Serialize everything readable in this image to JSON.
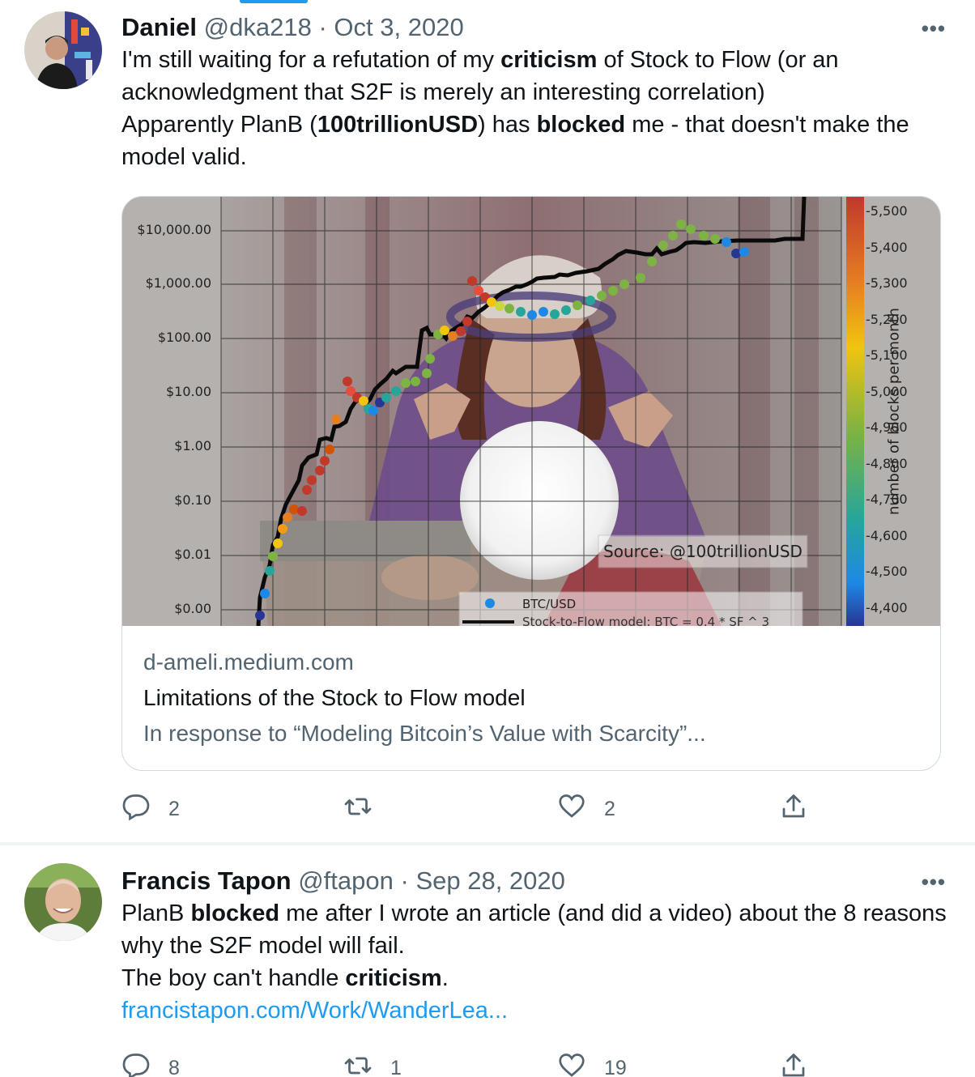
{
  "tweets": [
    {
      "name": "Daniel",
      "handle": "@dka218",
      "separator": "·",
      "date": "Oct 3, 2020",
      "more": "•••",
      "body": [
        {
          "t": "I'm still waiting for a refutation of my "
        },
        {
          "t": "criticism",
          "b": true
        },
        {
          "t": " of Stock to Flow (or an acknowledgment that S2F is merely an interesting correlation)"
        },
        {
          "br": true
        },
        {
          "t": "Apparently PlanB ("
        },
        {
          "t": "100trillionUSD",
          "b": true
        },
        {
          "t": ") has "
        },
        {
          "t": "blocked",
          "b": true
        },
        {
          "t": " me - that doesn't make the model valid."
        }
      ],
      "card": {
        "domain": "d-ameli.medium.com",
        "title": "Limitations of the Stock to Flow model",
        "description": "In response to “Modeling Bitcoin’s Value with Scarcity”..."
      },
      "actions": {
        "reply": "2",
        "retweet": "",
        "like": "2"
      }
    },
    {
      "name": "Francis Tapon",
      "handle": "@ftapon",
      "separator": "·",
      "date": "Sep 28, 2020",
      "more": "•••",
      "body": [
        {
          "t": "PlanB "
        },
        {
          "t": "blocked",
          "b": true
        },
        {
          "t": " me after I wrote an article (and did a video) about the 8 reasons why the S2F model will fail."
        },
        {
          "br": true
        },
        {
          "t": "The boy can't handle "
        },
        {
          "t": "criticism",
          "b": true
        },
        {
          "t": "."
        },
        {
          "br": true
        },
        {
          "t": "francistapon.com/Work/WanderLea...",
          "link": true
        }
      ],
      "actions": {
        "reply": "8",
        "retweet": "1",
        "like": "19"
      }
    }
  ],
  "chart_data": {
    "type": "scatter",
    "title": "",
    "xlabel": "",
    "ylabel": "",
    "yscale": "log",
    "y_tick_labels": [
      "$10,000.00",
      "$1,000.00",
      "$100.00",
      "$10.00",
      "$1.00",
      "$0.10",
      "$0.01",
      "$0.00"
    ],
    "colorbar_label": "number of blocks per month",
    "colorbar_ticks": [
      "5,500",
      "5,400",
      "5,300",
      "5,200",
      "5,100",
      "5,000",
      "4,900",
      "4,800",
      "4,700",
      "4,600",
      "4,500",
      "4,400"
    ],
    "annotation": "Source: @100trillionUSD",
    "legend": [
      "BTC/USD",
      "Stock-to-Flow model: BTC = 0.4 * SF ^ 3"
    ],
    "legend_position": "bottom-center"
  }
}
